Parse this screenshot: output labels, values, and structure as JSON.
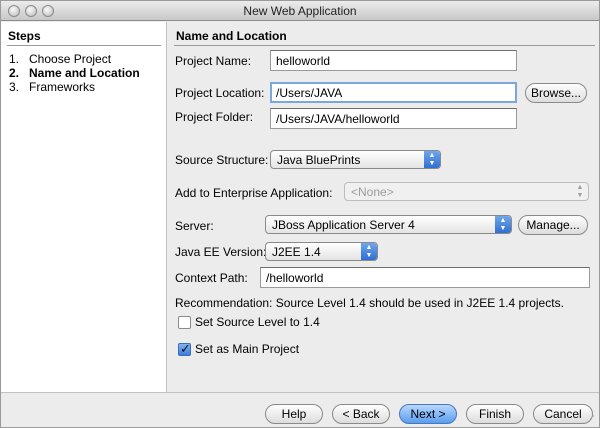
{
  "window": {
    "title": "New Web Application"
  },
  "steps": {
    "heading": "Steps",
    "items": [
      {
        "num": "1.",
        "label": "Choose Project"
      },
      {
        "num": "2.",
        "label": "Name and Location"
      },
      {
        "num": "3.",
        "label": "Frameworks"
      }
    ]
  },
  "panel": {
    "heading": "Name and Location",
    "project_name_label": "Project Name:",
    "project_name_value": "helloworld",
    "project_location_label": "Project Location:",
    "project_location_value": "/Users/JAVA",
    "browse_label": "Browse...",
    "project_folder_label": "Project Folder:",
    "project_folder_value": "/Users/JAVA/helloworld",
    "source_structure_label": "Source Structure:",
    "source_structure_value": "Java BluePrints",
    "enterprise_label": "Add to Enterprise Application:",
    "enterprise_value": "<None>",
    "server_label": "Server:",
    "server_value": "JBoss Application Server 4",
    "manage_label": "Manage...",
    "javaee_label": "Java EE Version:",
    "javaee_value": "J2EE 1.4",
    "context_path_label": "Context Path:",
    "context_path_value": "/helloworld",
    "recommendation": "Recommendation: Source Level 1.4 should be used in J2EE 1.4 projects.",
    "source_level_label": "Set Source Level to 1.4",
    "source_level_checked": false,
    "main_project_label": "Set as Main Project",
    "main_project_checked": true
  },
  "buttons": {
    "help": "Help",
    "back": "< Back",
    "next": "Next >",
    "finish": "Finish",
    "cancel": "Cancel"
  }
}
